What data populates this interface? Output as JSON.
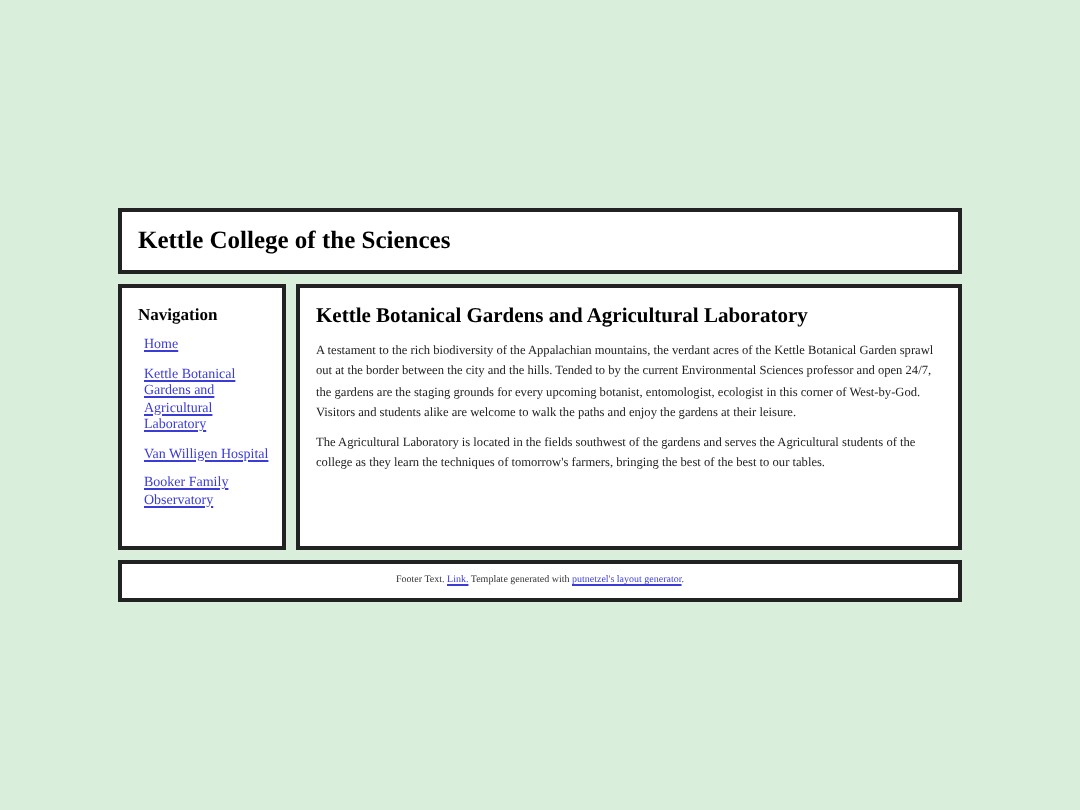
{
  "header": {
    "title": "Kettle College of the Sciences"
  },
  "navigation": {
    "heading": "Navigation",
    "items": [
      "Home",
      "Kettle Botanical Gardens and Agricultural Laboratory",
      "Van Willigen Hospital",
      "Booker Family Observatory"
    ]
  },
  "main": {
    "heading": "Kettle Botanical Gardens and Agricultural Laboratory",
    "paragraphs": [
      "A testament to the rich biodiversity of the Appalachian mountains, the verdant acres of the Kettle Botanical Garden sprawl out at the border between the city and the hills. Tended to by the current Environmental Sciences professor and open 24/7, the gardens are the staging grounds for every upcoming botanist, entomologist, ecologist in this corner of West-by-God. Visitors and students alike are welcome to walk the paths and enjoy the gardens at their leisure.",
      "The Agricultural Laboratory is located in the fields southwest of the gardens and serves the Agricultural students of the college as they learn the techniques of tomorrow's farmers, bringing the best of the best to our tables."
    ]
  },
  "footer": {
    "parts": [
      {
        "kind": "text",
        "text": "Footer Text. "
      },
      {
        "kind": "link",
        "text": "Link."
      },
      {
        "kind": "text",
        "text": " Template generated with "
      },
      {
        "kind": "link",
        "text": "putnetzel's layout generator"
      },
      {
        "kind": "text",
        "text": "."
      }
    ]
  }
}
